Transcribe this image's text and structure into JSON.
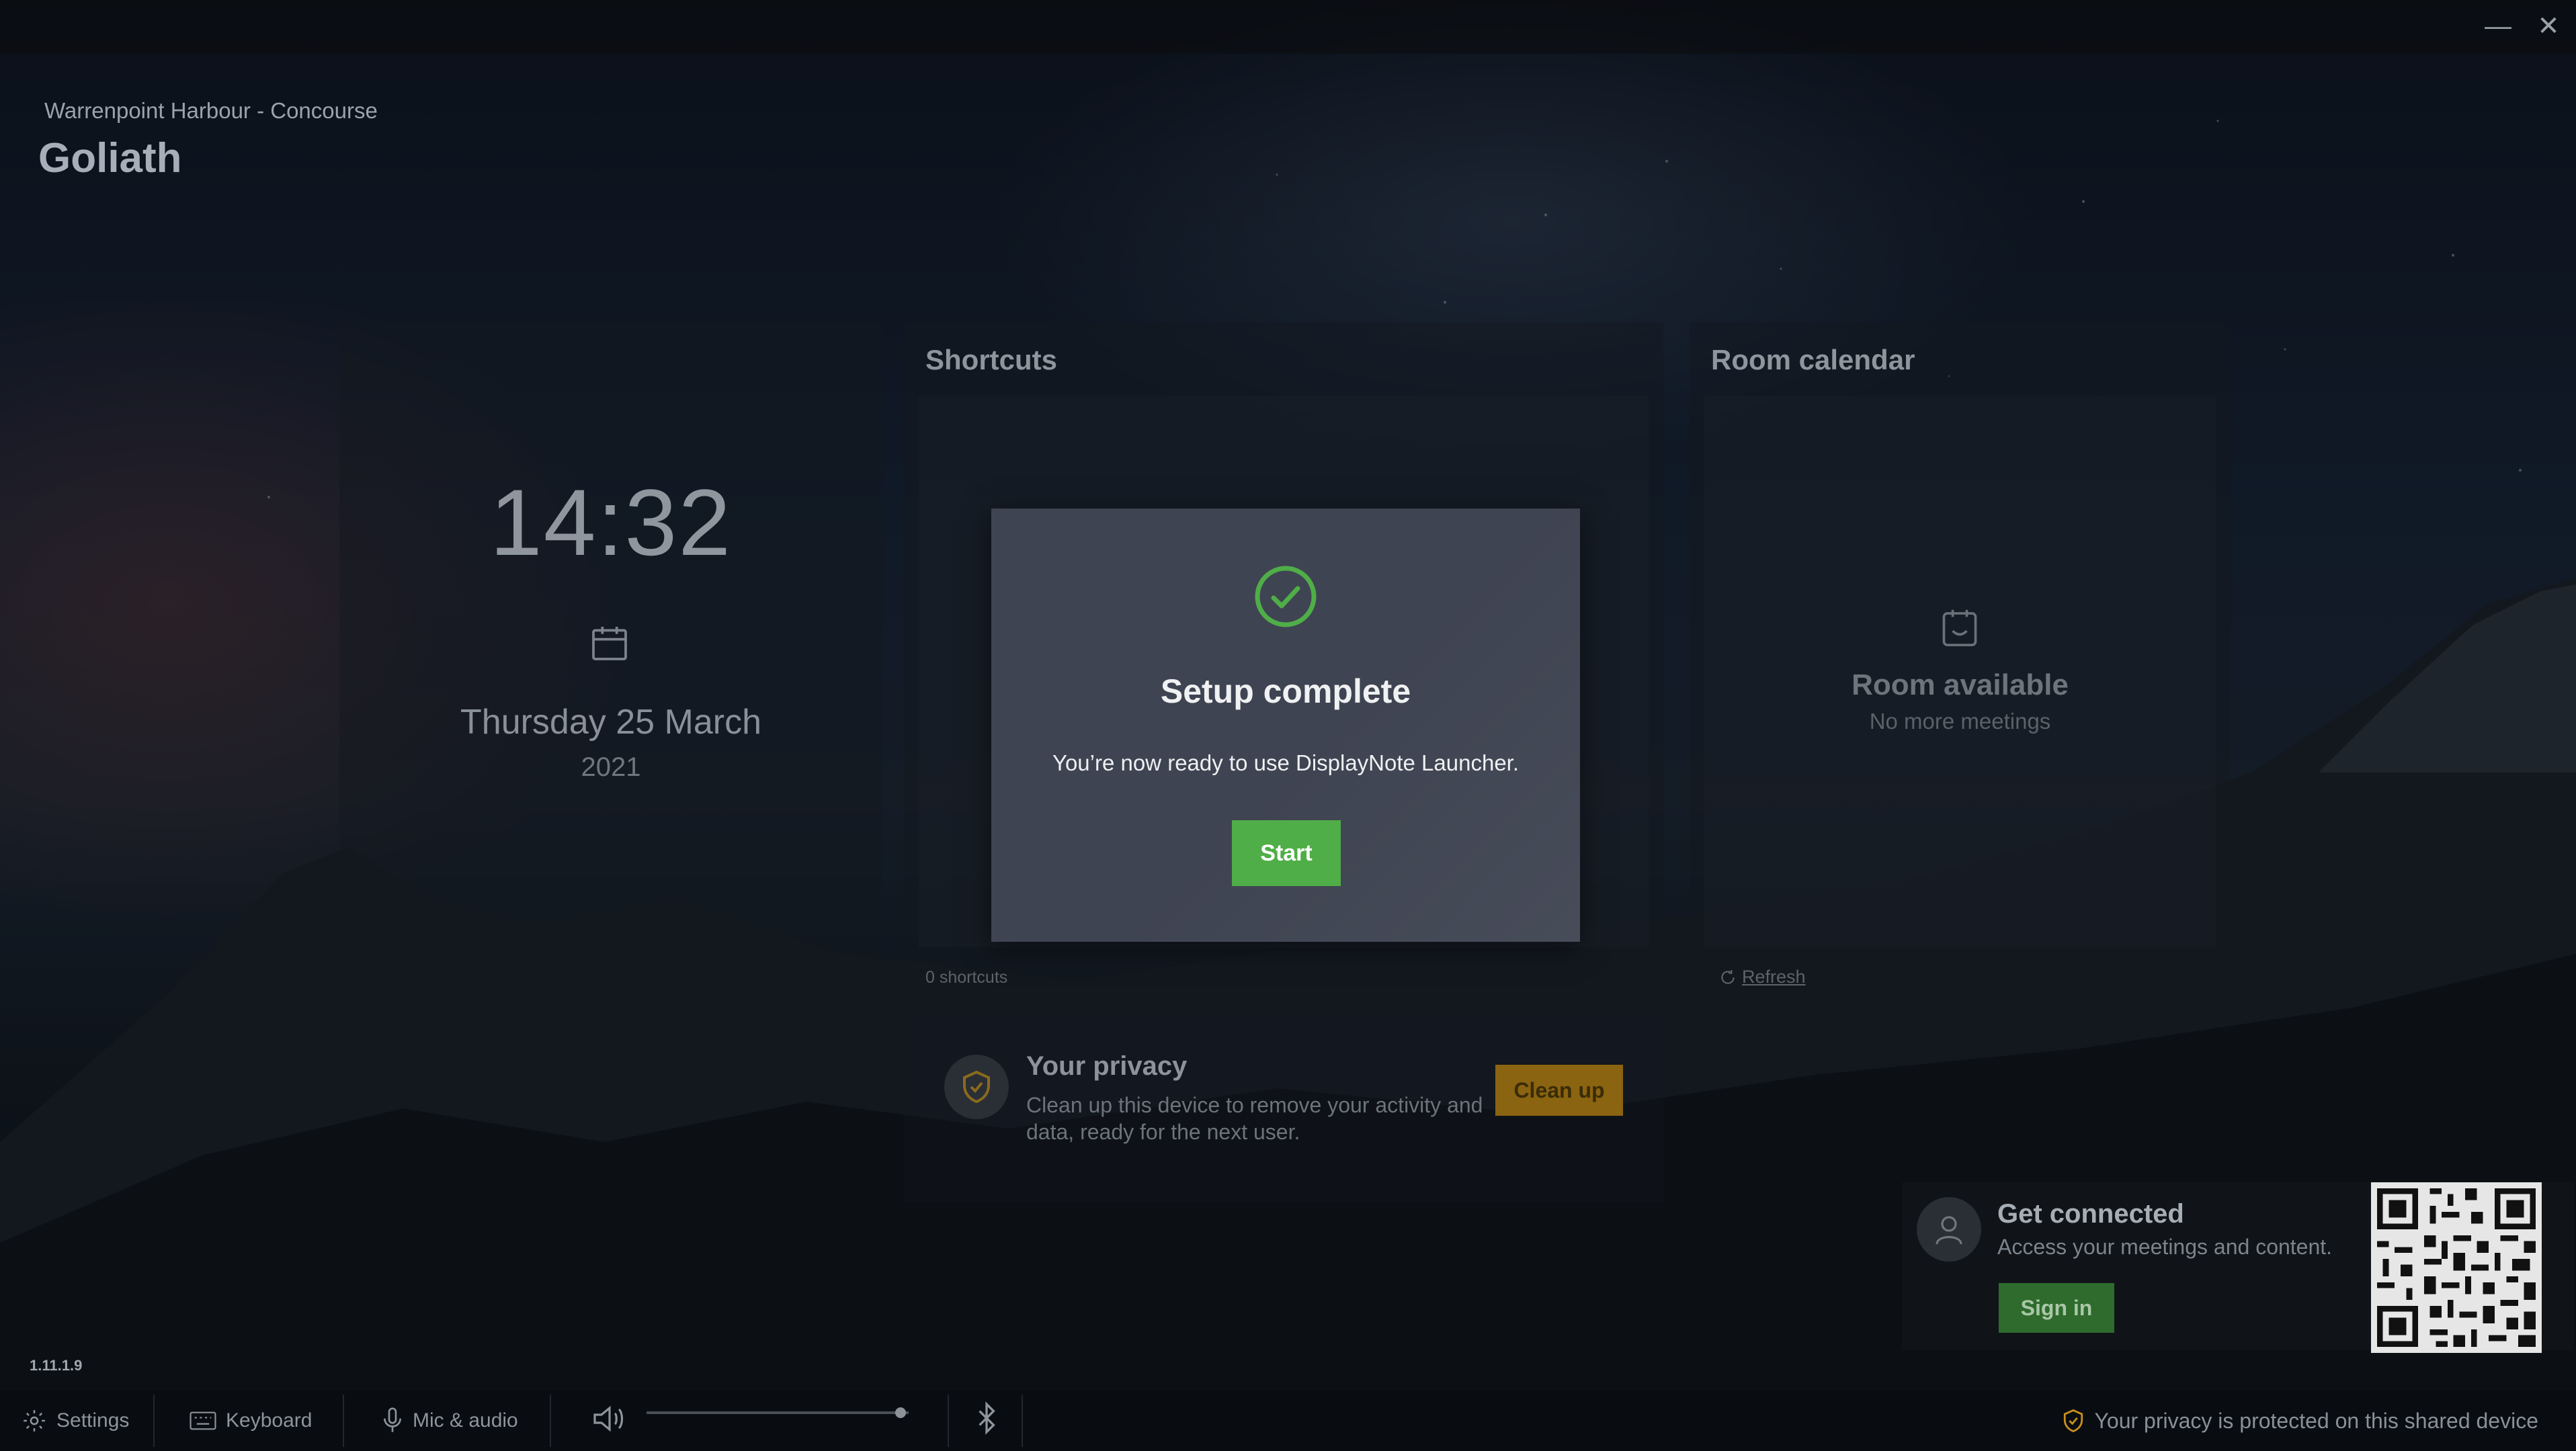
{
  "window": {
    "minimize_glyph": "—",
    "close_glyph": "✕"
  },
  "header": {
    "location": "Warrenpoint Harbour - Concourse",
    "room_name": "Goliath"
  },
  "clock": {
    "time": "14:32",
    "date": "Thursday 25 March",
    "year": "2021",
    "icon": "calendar-icon"
  },
  "shortcuts": {
    "title": "Shortcuts",
    "count_label": "0 shortcuts"
  },
  "room_calendar": {
    "title": "Room calendar",
    "status": "Room available",
    "sub": "No more meetings",
    "refresh_label": "Refresh",
    "icon": "calendar-smile-icon"
  },
  "privacy_card": {
    "title": "Your privacy",
    "description": "Clean up this device to remove your activity and data, ready for the next user.",
    "button_label": "Clean up",
    "icon": "shield-check-icon"
  },
  "get_connected": {
    "title": "Get connected",
    "description": "Access your meetings and content.",
    "button_label": "Sign in",
    "icon": "user-icon"
  },
  "version": "1.11.1.9",
  "bottom_bar": {
    "settings_label": "Settings",
    "keyboard_label": "Keyboard",
    "mic_label": "Mic & audio",
    "volume_level": 0.97,
    "privacy_notice": "Your privacy is protected on this shared device"
  },
  "modal": {
    "title": "Setup complete",
    "message": "You’re now ready to use DisplayNote Launcher.",
    "button_label": "Start",
    "icon": "check-circle-icon"
  },
  "colors": {
    "accent_green": "#4fae47",
    "warning_orange": "#c8901a",
    "modal_bg": "#3f4452"
  }
}
